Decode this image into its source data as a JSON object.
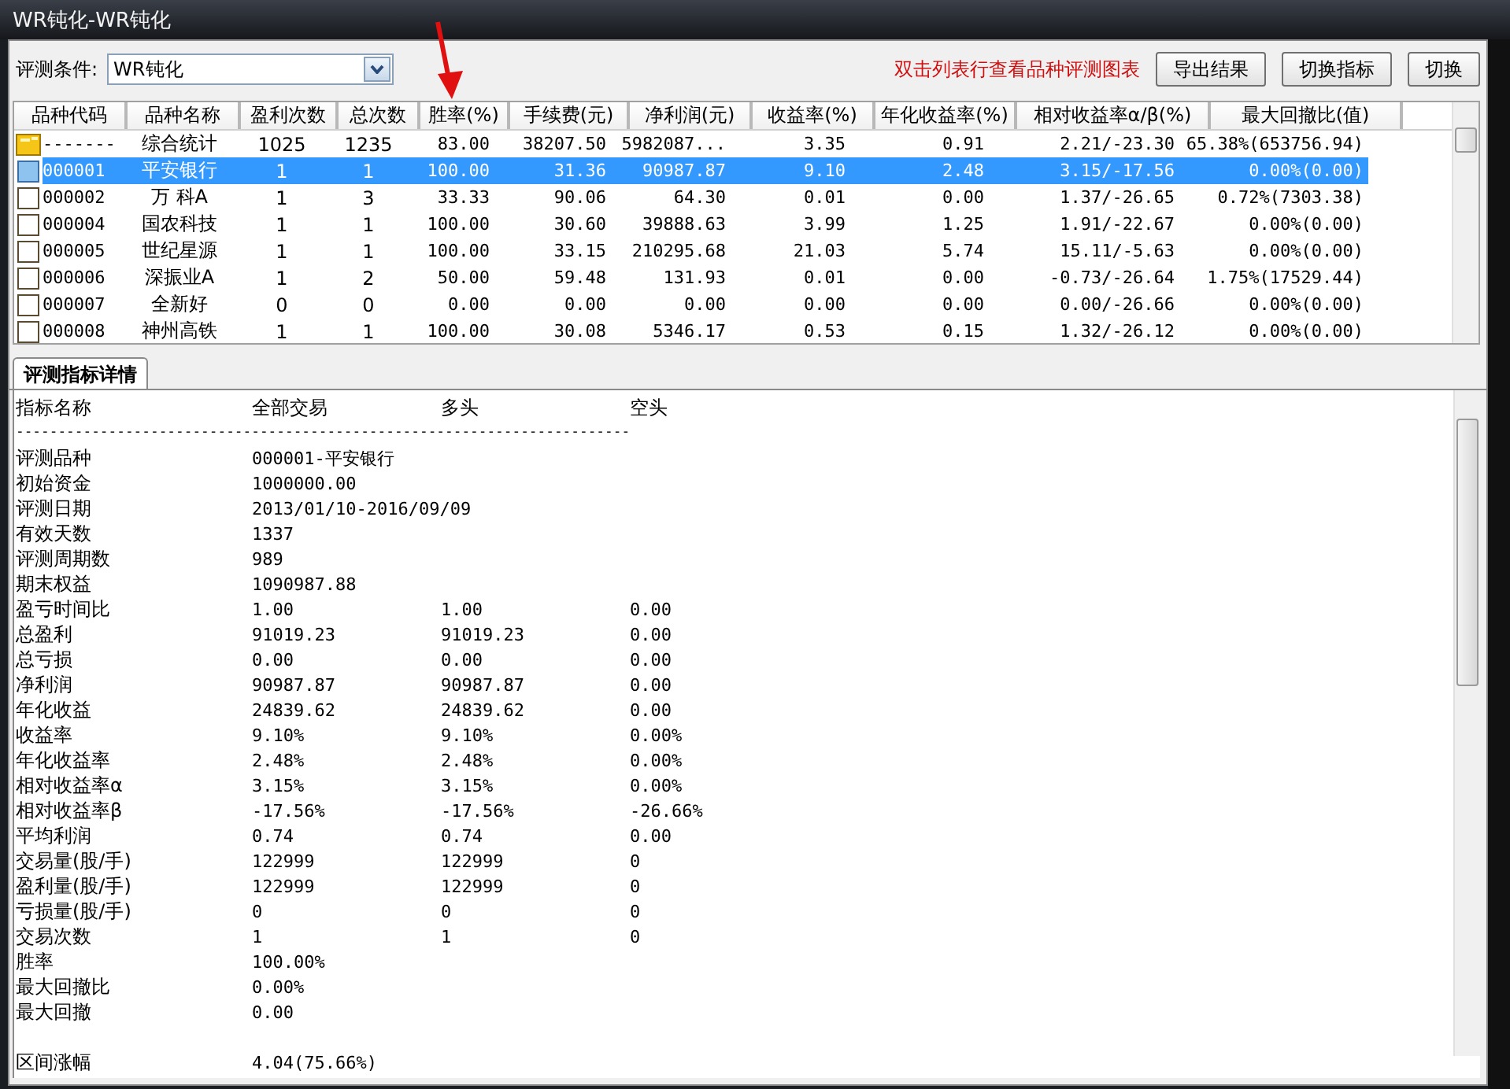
{
  "window": {
    "title": "WR钝化-WR钝化"
  },
  "toolbar": {
    "label": "评测条件:",
    "condition": "WR钝化",
    "hint": "双击列表行查看品种评测图表",
    "buttons": [
      "导出结果",
      "切换指标",
      "切换"
    ]
  },
  "table": {
    "columns": [
      "品种代码",
      "品种名称",
      "盈利次数",
      "总次数",
      "胜率(%)",
      "手续费(元)",
      "净利润(元)",
      "收益率(%)",
      "年化收益率(%)",
      "相对收益率α/β(%)",
      "最大回撤比(值)"
    ],
    "rows": [
      {
        "kind": "summary",
        "selected": false,
        "cells": [
          "-------",
          "综合统计",
          "1025",
          "1235",
          "83.00",
          "38207.50",
          "5982087...",
          "3.35",
          "0.91",
          "2.21/-23.30",
          "65.38%(653756.94)"
        ]
      },
      {
        "kind": "stock",
        "selected": true,
        "cells": [
          "000001",
          "平安银行",
          "1",
          "1",
          "100.00",
          "31.36",
          "90987.87",
          "9.10",
          "2.48",
          "3.15/-17.56",
          "0.00%(0.00)"
        ]
      },
      {
        "kind": "stock",
        "selected": false,
        "cells": [
          "000002",
          "万 科A",
          "1",
          "3",
          "33.33",
          "90.06",
          "64.30",
          "0.01",
          "0.00",
          "1.37/-26.65",
          "0.72%(7303.38)"
        ]
      },
      {
        "kind": "stock",
        "selected": false,
        "cells": [
          "000004",
          "国农科技",
          "1",
          "1",
          "100.00",
          "30.60",
          "39888.63",
          "3.99",
          "1.25",
          "1.91/-22.67",
          "0.00%(0.00)"
        ]
      },
      {
        "kind": "stock",
        "selected": false,
        "cells": [
          "000005",
          "世纪星源",
          "1",
          "1",
          "100.00",
          "33.15",
          "210295.68",
          "21.03",
          "5.74",
          "15.11/-5.63",
          "0.00%(0.00)"
        ]
      },
      {
        "kind": "stock",
        "selected": false,
        "cells": [
          "000006",
          "深振业A",
          "1",
          "2",
          "50.00",
          "59.48",
          "131.93",
          "0.01",
          "0.00",
          "-0.73/-26.64",
          "1.75%(17529.44)"
        ]
      },
      {
        "kind": "stock",
        "selected": false,
        "cells": [
          "000007",
          "全新好",
          "0",
          "0",
          "0.00",
          "0.00",
          "0.00",
          "0.00",
          "0.00",
          "0.00/-26.66",
          "0.00%(0.00)"
        ]
      },
      {
        "kind": "stock",
        "selected": false,
        "cells": [
          "000008",
          "神州高铁",
          "1",
          "1",
          "100.00",
          "30.08",
          "5346.17",
          "0.53",
          "0.15",
          "1.32/-26.12",
          "0.00%(0.00)"
        ]
      }
    ]
  },
  "tabs": [
    {
      "label": "评测指标详情",
      "selected": true
    }
  ],
  "details": {
    "columns": [
      "指标名称",
      "全部交易",
      "多头",
      "空头"
    ],
    "separator": "-------------------------------------------------------------------------",
    "rows": [
      [
        "评测品种",
        "000001-平安银行"
      ],
      [
        "初始资金",
        "1000000.00"
      ],
      [
        "评测日期",
        "2013/01/10-2016/09/09"
      ],
      [
        "有效天数",
        "1337"
      ],
      [
        "评测周期数",
        "989"
      ],
      [
        "期末权益",
        "1090987.88"
      ],
      [
        "盈亏时间比",
        "1.00",
        "1.00",
        "0.00"
      ],
      [
        "总盈利",
        "91019.23",
        "91019.23",
        "0.00"
      ],
      [
        "总亏损",
        "0.00",
        "0.00",
        "0.00"
      ],
      [
        "净利润",
        "90987.87",
        "90987.87",
        "0.00"
      ],
      [
        "年化收益",
        "24839.62",
        "24839.62",
        "0.00"
      ],
      [
        "收益率",
        "9.10%",
        "9.10%",
        "0.00%"
      ],
      [
        "年化收益率",
        "2.48%",
        "2.48%",
        "0.00%"
      ],
      [
        "相对收益率α",
        "3.15%",
        "3.15%",
        "0.00%"
      ],
      [
        "相对收益率β",
        "-17.56%",
        "-17.56%",
        "-26.66%"
      ],
      [
        "平均利润",
        "0.74",
        "0.74",
        "0.00"
      ],
      [
        "交易量(股/手)",
        "122999",
        "122999",
        "0"
      ],
      [
        "盈利量(股/手)",
        "122999",
        "122999",
        "0"
      ],
      [
        "亏损量(股/手)",
        "0",
        "0",
        "0"
      ],
      [
        "交易次数",
        "1",
        "1",
        "0"
      ],
      [
        "胜率",
        "100.00%"
      ],
      [
        "最大回撤比",
        "0.00%"
      ],
      [
        "最大回撤",
        "0.00"
      ]
    ],
    "range_rows": [
      [
        "区间涨幅",
        "4.04(75.66%)"
      ]
    ]
  }
}
